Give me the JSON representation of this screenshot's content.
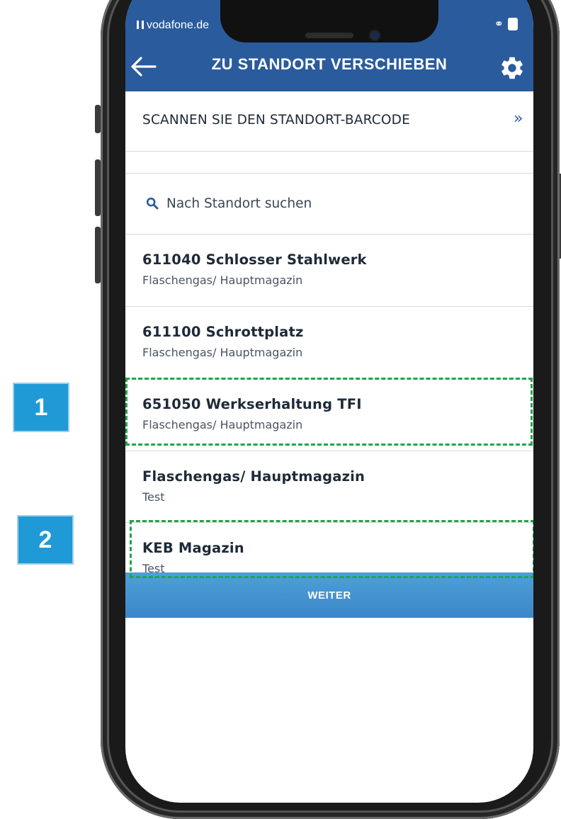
{
  "status_bar": {
    "carrier": "vodafone.de"
  },
  "header": {
    "title": "ZU STANDORT VERSCHIEBEN"
  },
  "scan": {
    "label": "SCANNEN SIE DEN STANDORT-BARCODE",
    "chevron": "»"
  },
  "search": {
    "placeholder": "Nach Standort suchen"
  },
  "locations": [
    {
      "name": "611040 Schlosser Stahlwerk",
      "sub": "Flaschengas/ Hauptmagazin"
    },
    {
      "name": "611100 Schrottplatz",
      "sub": "Flaschengas/ Hauptmagazin"
    },
    {
      "name": "651050 Werkserhaltung TFI",
      "sub": "Flaschengas/ Hauptmagazin"
    },
    {
      "name": "Flaschengas/ Hauptmagazin",
      "sub": "Test"
    },
    {
      "name": "KEB Magazin",
      "sub": "Test"
    }
  ],
  "footer": {
    "button_label": "WEITER"
  },
  "callouts": {
    "step1": "1",
    "step2": "2"
  },
  "icons": {
    "back": "arrow-left-icon",
    "settings": "gear-icon",
    "search": "search-icon",
    "scan_chevron": "double-chevron-right-icon"
  },
  "colors": {
    "header": "#2a5b9c",
    "button": "#4394d2",
    "callout": "#1f9ad6",
    "highlight": "#1fa64a"
  }
}
